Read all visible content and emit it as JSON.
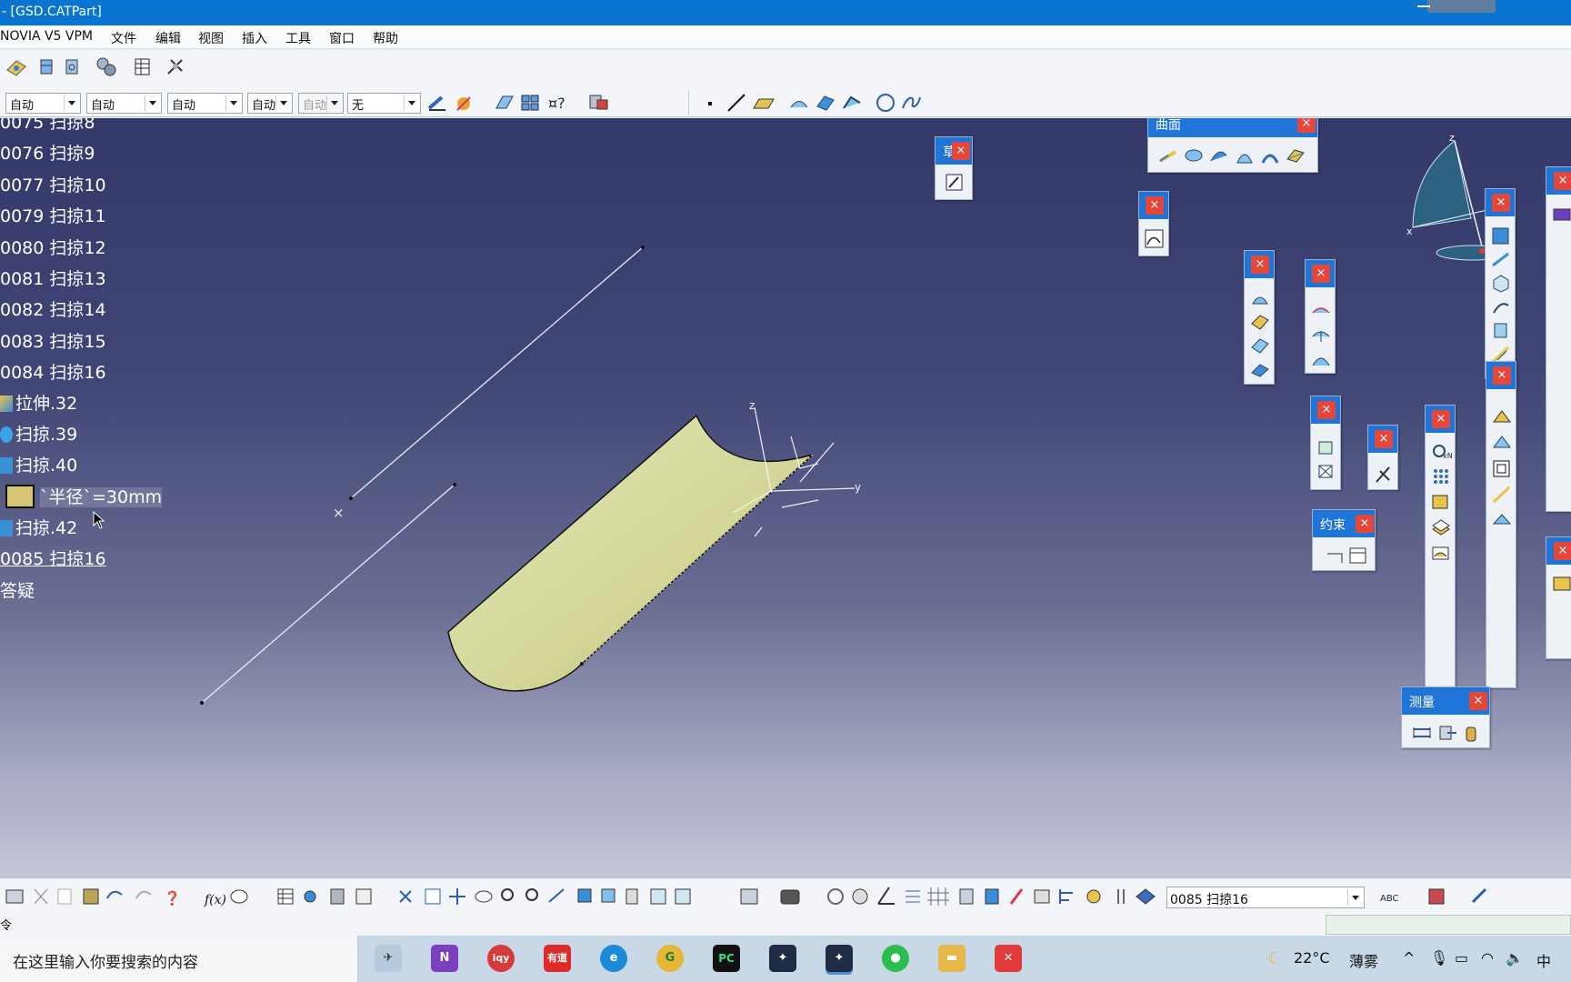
{
  "window": {
    "title": "- [GSD.CATPart]"
  },
  "menu": {
    "items": [
      "NOVIA V5 VPM",
      "文件",
      "编辑",
      "视图",
      "插入",
      "工具",
      "窗口",
      "帮助"
    ]
  },
  "toolbar": {
    "combos": [
      "自动",
      "自动",
      "自动",
      "自动",
      "自动",
      "无"
    ]
  },
  "tree": {
    "items": [
      "0075 扫掠8",
      "0076 扫掠9",
      "0077 扫掠10",
      "0079 扫掠11",
      "0080 扫掠12",
      "0081 扫掠13",
      "0082 扫掠14",
      "0083 扫掠15",
      "0084 扫掠16",
      "拉伸.32",
      "扫掠.39",
      "扫掠.40",
      "`半径`=30mm",
      "扫掠.42",
      "0085 扫掠16",
      "答疑"
    ]
  },
  "panels": {
    "surface": "曲面",
    "sketch_partial": "草",
    "constraint": "约束",
    "measure": "测量",
    "close_glyph": "×"
  },
  "axes": {
    "z": "z",
    "y": "y",
    "x": "x"
  },
  "bottom": {
    "selected_feature": "0085 扫掠16"
  },
  "status": {
    "command": "令"
  },
  "taskbar": {
    "search_placeholder": "在这里输入你要搜索的内容",
    "apps": [
      "N",
      "iqy",
      "有道",
      "e",
      "G",
      "PC",
      "",
      "",
      "",
      "",
      "",
      ""
    ],
    "weather_temp": "22°C",
    "weather_text": "薄雾",
    "ime": "中"
  },
  "colors": {
    "titlebar": "#0a74d1",
    "panel_header": "#1f74d7",
    "close_red": "#e4463a",
    "surface_fill": "#d3d69a",
    "viewport_top": "#35396a",
    "viewport_bottom": "#c4c6d8"
  }
}
